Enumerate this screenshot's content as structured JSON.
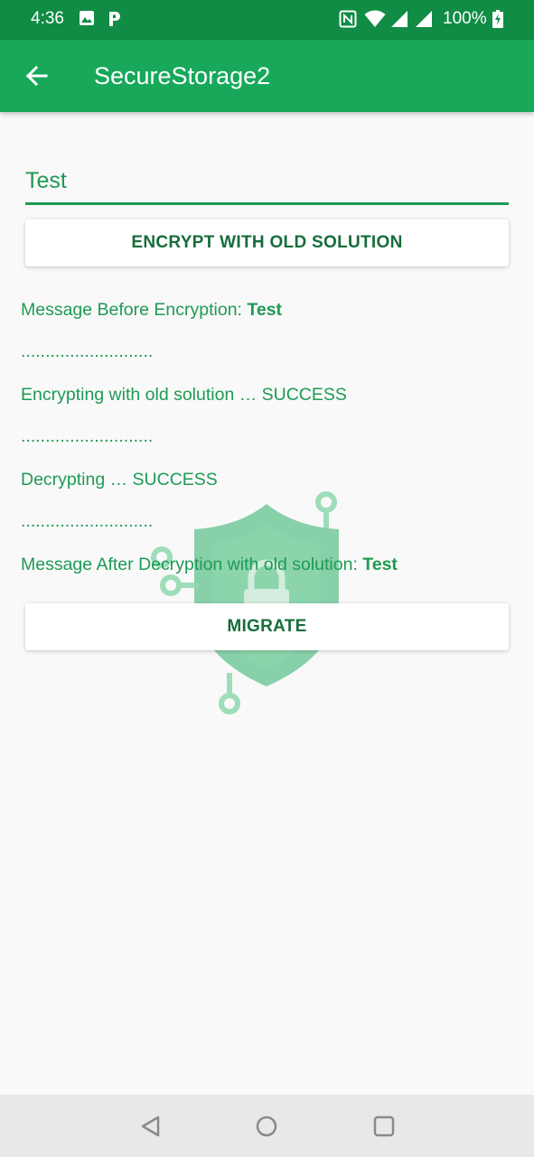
{
  "status_bar": {
    "time": "4:36",
    "battery": "100%",
    "icons": [
      "image-icon",
      "p-app-icon",
      "nfc-icon",
      "wifi-icon",
      "signal-icon",
      "signal-icon",
      "battery-charging-icon"
    ]
  },
  "app_bar": {
    "title": "SecureStorage2",
    "back_icon": "arrow-left-icon"
  },
  "message_input": {
    "value": "Test"
  },
  "encrypt_button": {
    "label": "ENCRYPT WITH OLD SOLUTION"
  },
  "log": {
    "before_label": "Message Before Encryption: ",
    "before_value": "Test",
    "separator_1": "...........................",
    "encrypting": "Encrypting with old solution … SUCCESS",
    "separator_2": "...........................",
    "decrypting": "Decrypting … SUCCESS",
    "separator_3": "...........................",
    "after_label": "Message After Decryption with old solution: ",
    "after_value": "Test"
  },
  "migrate_button": {
    "label": "MIGRATE"
  },
  "nav_bar": {
    "back": "triangle-back-icon",
    "home": "circle-home-icon",
    "recents": "square-recents-icon"
  },
  "colors": {
    "status_bar": "#108c45",
    "app_bar": "#17a85a",
    "accent": "#1e9a54",
    "button_text": "#166d3b",
    "background": "#f9f9f9"
  }
}
